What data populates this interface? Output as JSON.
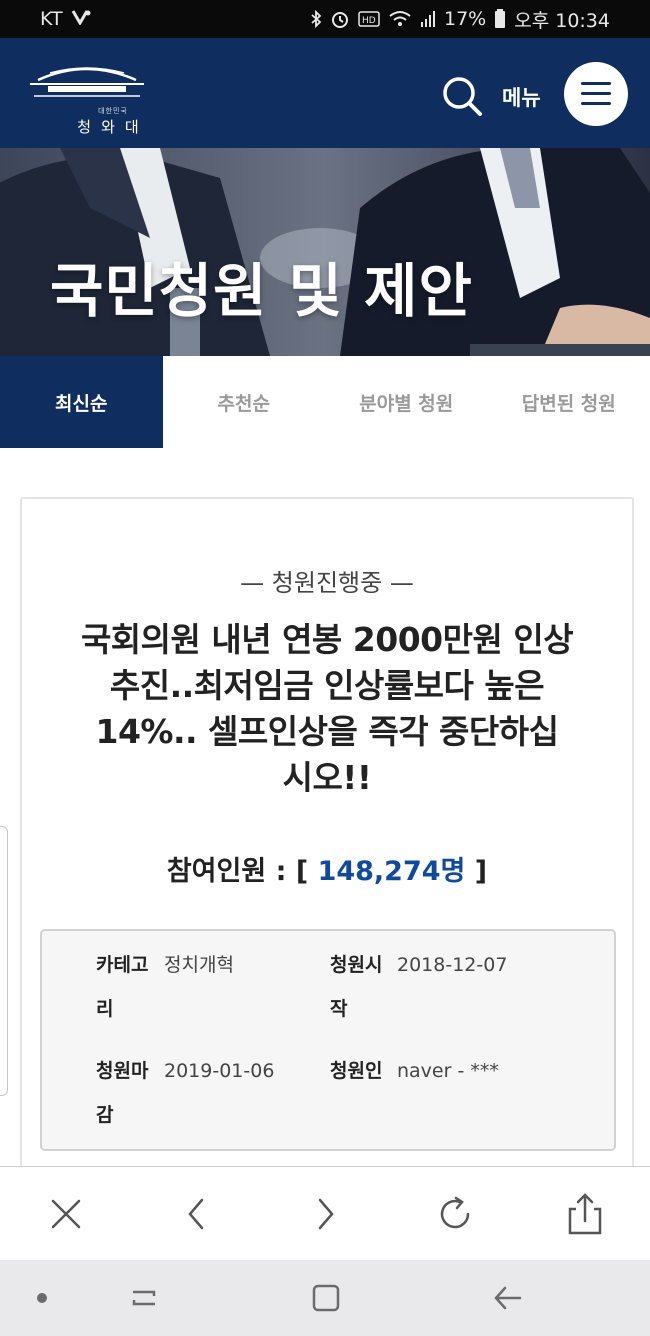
{
  "status_bar": {
    "carrier": "KT",
    "battery": "17%",
    "time": "오후 10:34",
    "icons": [
      "bluetooth-icon",
      "alarm-icon",
      "hd-icon",
      "wifi-icon",
      "signal-icon",
      "battery-icon"
    ]
  },
  "header": {
    "logo_small": "대한민국",
    "logo_name": "청와대",
    "menu_label": "메뉴"
  },
  "hero": {
    "title": "국민청원 및 제안"
  },
  "tabs": [
    {
      "label": "최신순",
      "active": true
    },
    {
      "label": "추천순",
      "active": false
    },
    {
      "label": "분야별 청원",
      "active": false
    },
    {
      "label": "답변된 청원",
      "active": false
    }
  ],
  "petition": {
    "state": "청원진행중",
    "title_lines": [
      "국회의원 내년 연봉 2000만원 인상",
      "추진..최저임금 인상률보다 높은",
      "14%.. 셀프인상을 즉각 중단하십",
      "시오!!"
    ],
    "participants_label": "참여인원 :",
    "participants_open": "[",
    "participants_count": "148,274명",
    "participants_close": "]",
    "info": {
      "category_label_1": "카테고",
      "category_label_2": "리",
      "category_value": "정치개혁",
      "start_label_1": "청원시",
      "start_label_2": "작",
      "start_value": "2018-12-07",
      "end_label_1": "청원마",
      "end_label_2": "감",
      "end_value": "2019-01-06",
      "author_label": "청원인",
      "author_value": "naver - ***"
    }
  },
  "colors": {
    "brand_navy": "#0f2d5e",
    "count_blue": "#0f4a9e"
  }
}
